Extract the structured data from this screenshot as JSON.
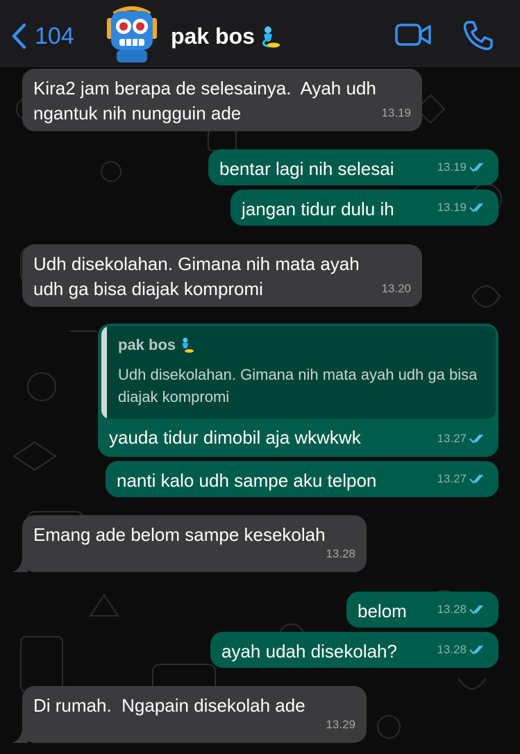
{
  "header": {
    "back_count": "104",
    "contact_name": "pak bos"
  },
  "messages": [
    {
      "dir": "in",
      "text": "Kira2 jam berapa de selesainya.  Ayah udh\nngantuk nih nungguin ade",
      "time": "13.19"
    },
    {
      "dir": "out",
      "text": "bentar lagi nih selesai",
      "time": "13.19"
    },
    {
      "dir": "out",
      "text": "jangan tidur dulu ih",
      "time": "13.19"
    },
    {
      "dir": "in",
      "text": "Udh disekolahan. Gimana nih mata ayah\nudh ga bisa diajak kompromi",
      "time": "13.20"
    },
    {
      "dir": "out",
      "text": "yauda tidur dimobil aja wkwkwk",
      "time": "13.27"
    },
    {
      "dir": "out",
      "text": "nanti kalo udh sampe aku telpon",
      "time": "13.27"
    },
    {
      "dir": "in",
      "text": "Emang ade belom sampe kesekolah",
      "time": "13.28"
    },
    {
      "dir": "out",
      "text": "belom",
      "time": "13.28"
    },
    {
      "dir": "out",
      "text": "ayah udah disekolah?",
      "time": "13.28"
    },
    {
      "dir": "in",
      "text": "Di rumah.  Ngapain disekolah ade",
      "time": "13.29"
    }
  ],
  "quote": {
    "name": "pak bos",
    "text": "Udh disekolahan. Gimana nih mata ayah udh ga bisa diajak kompromi"
  },
  "colors": {
    "incoming_bubble": "#3b3b3d",
    "outgoing_bubble": "#005c4b",
    "accent": "#3a8ff5",
    "read_ticks": "#53bdeb"
  },
  "icons": {
    "back": "chevron-left-icon",
    "avatar": "robot-avatar-icon",
    "name_emoji": "genie-icon",
    "video": "video-camera-icon",
    "call": "phone-icon",
    "read_receipt": "double-check-icon"
  }
}
